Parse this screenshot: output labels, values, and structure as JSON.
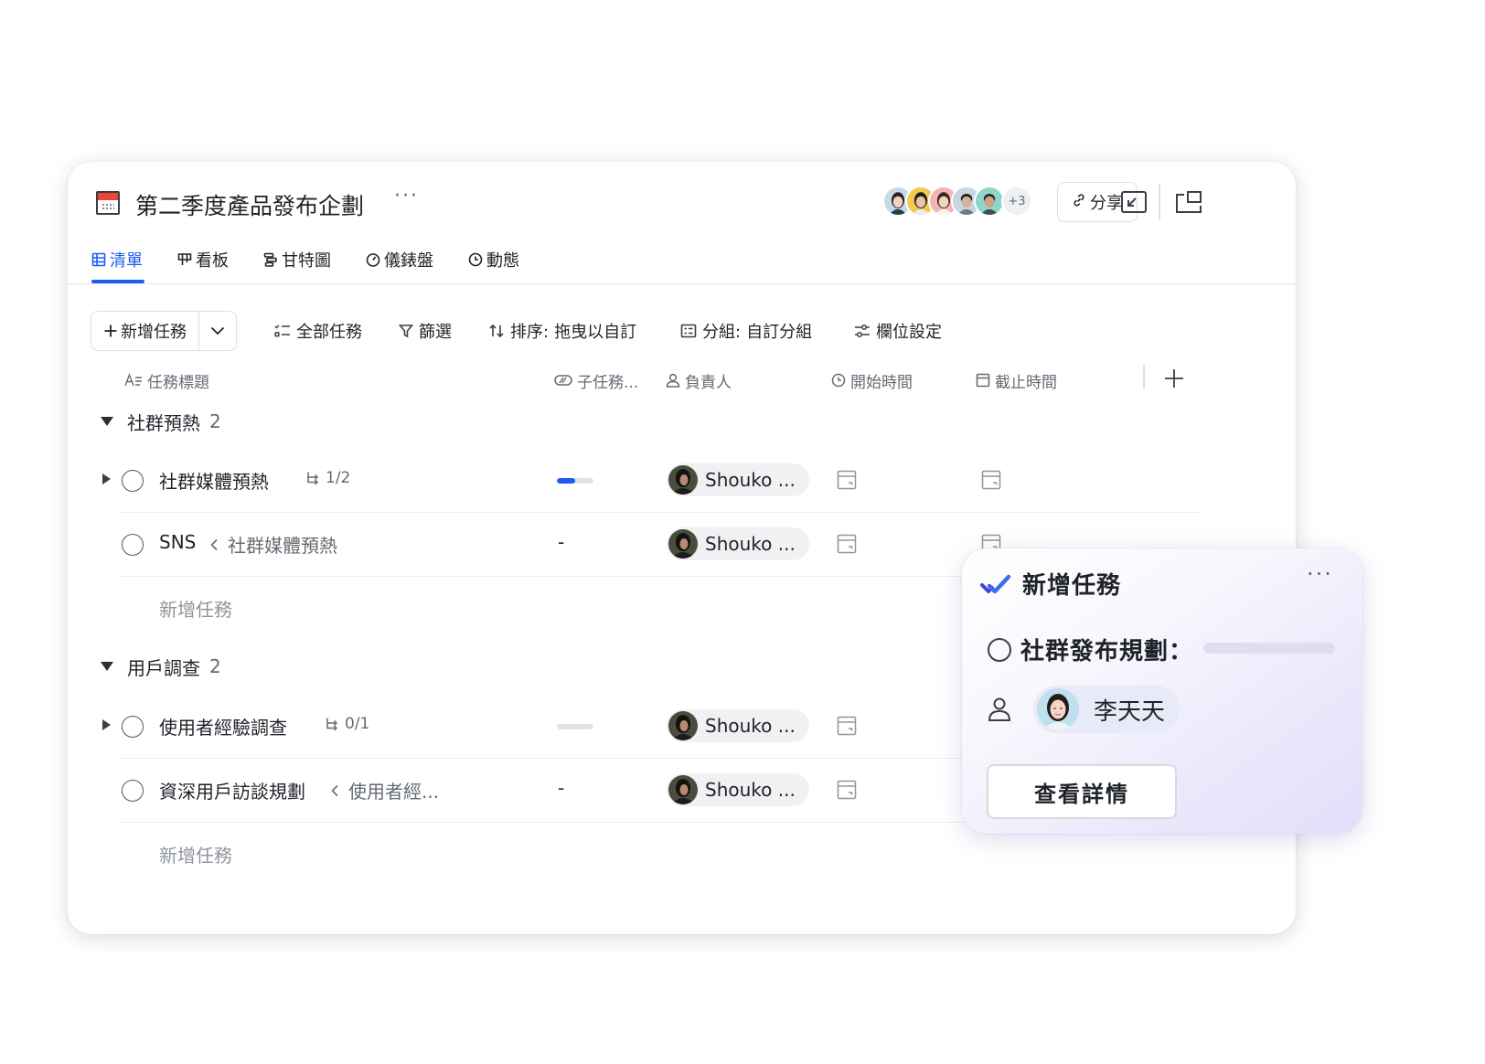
{
  "project": {
    "title": "第二季度產品發布企劃",
    "more": "···"
  },
  "header": {
    "avatars_more": "+3",
    "share_label": "分享"
  },
  "tabs": [
    {
      "label": "清單",
      "icon": "list-grid-icon",
      "active": true
    },
    {
      "label": "看板",
      "icon": "kanban-icon",
      "active": false
    },
    {
      "label": "甘特圖",
      "icon": "gantt-icon",
      "active": false
    },
    {
      "label": "儀錶盤",
      "icon": "dashboard-icon",
      "active": false
    },
    {
      "label": "動態",
      "icon": "history-icon",
      "active": false
    }
  ],
  "toolbar": {
    "add_task": "新增任務",
    "all_tasks": "全部任務",
    "filter": "篩選",
    "sort_label": "排序:",
    "sort_value": "拖曳以自訂",
    "group_label": "分組:",
    "group_value": "自訂分組",
    "field_settings": "欄位設定"
  },
  "columns": {
    "title": "任務標題",
    "subtasks": "子任務...",
    "assignee": "負責人",
    "start": "開始時間",
    "due": "截止時間"
  },
  "groups": [
    {
      "name": "社群預熱",
      "count": "2",
      "tasks": [
        {
          "name": "社群媒體預熱",
          "subtasks": "1/2",
          "progress": 0.5,
          "assignee": "Shouko ..."
        },
        {
          "name": "SNS",
          "parent": "社群媒體預熱",
          "progress_text": "-",
          "assignee": "Shouko ..."
        }
      ],
      "new_task": "新增任務"
    },
    {
      "name": "用戶調查",
      "count": "2",
      "tasks": [
        {
          "name": "使用者經驗調查",
          "subtasks": "0/1",
          "progress": 0,
          "assignee": "Shouko ..."
        },
        {
          "name": "資深用戶訪談規劃",
          "parent": "使用者經...",
          "progress_text": "-",
          "assignee": "Shouko ..."
        }
      ],
      "new_task": "新增任務"
    }
  ],
  "popup": {
    "title": "新增任務",
    "more": "···",
    "task": "社群發布規劃：",
    "assignee": "李天天",
    "button": "查看詳情"
  },
  "colors": {
    "accent": "#1e5bf0",
    "popup_check": "#4a3fd9"
  }
}
